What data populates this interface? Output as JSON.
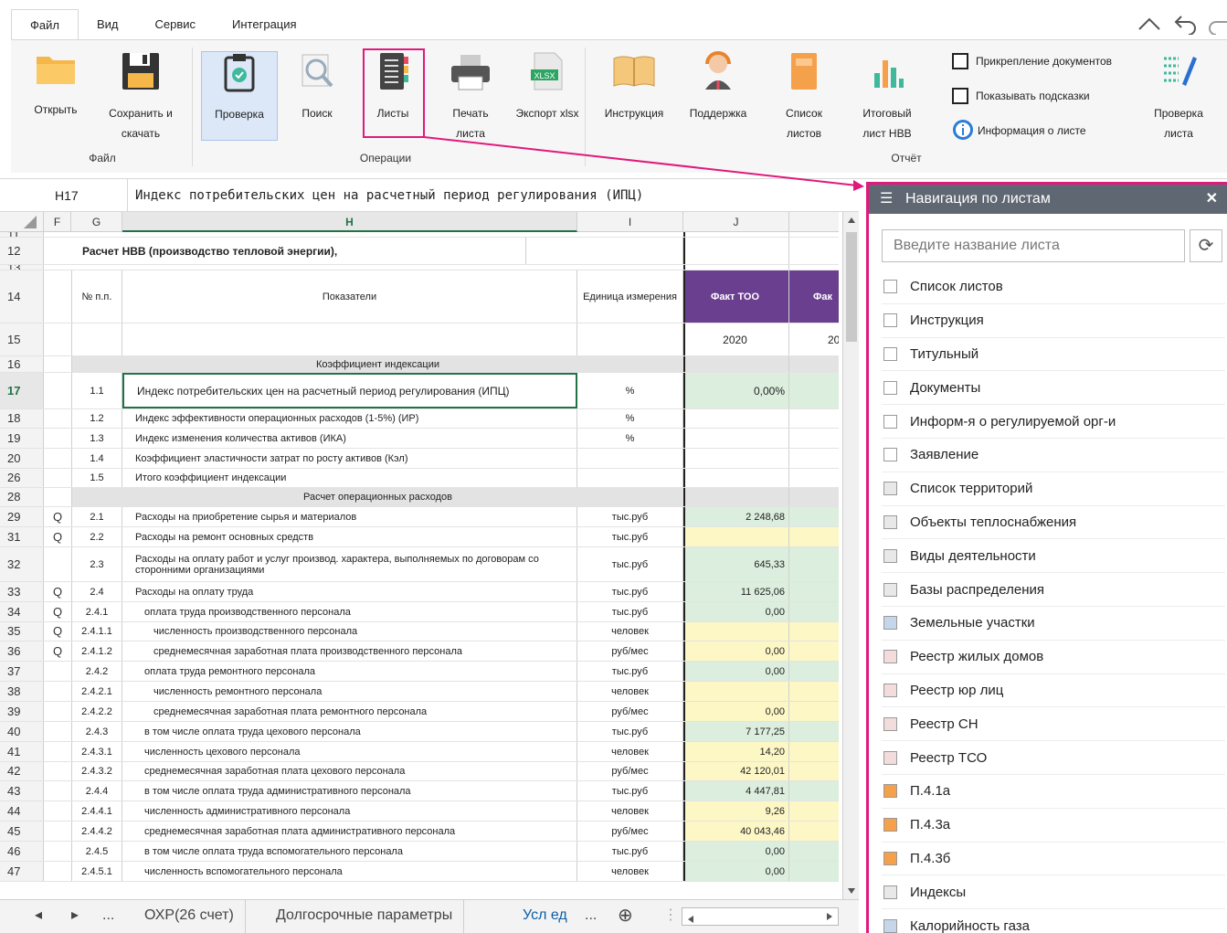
{
  "ribbon": {
    "tabs": [
      "Файл",
      "Вид",
      "Сервис",
      "Интеграция"
    ],
    "buttons": {
      "open": "Открыть",
      "save": "Сохранить и скачать",
      "check": "Проверка",
      "search": "Поиск",
      "sheets": "Листы",
      "print": "Печать листа",
      "export": "Экспорт xlsx",
      "export_badge": "XLSX",
      "instructions": "Инструкция",
      "support": "Поддержка",
      "sheet_list": "Список листов",
      "total_sheet": "Итоговый лист НВВ",
      "check_sheet": "Проверка листа"
    },
    "groups": {
      "file": "Файл",
      "operations": "Операции",
      "report": "Отчёт"
    },
    "checks": {
      "attach": "Прикрепление документов",
      "hints": "Показывать подсказки",
      "info": "Информация о листе"
    }
  },
  "formula_bar": {
    "cell_ref": "H17",
    "formula": "Индекс потребительских цен на расчетный период регулирования (ИПЦ)"
  },
  "grid": {
    "columns": [
      "F",
      "G",
      "H",
      "I",
      "J"
    ],
    "rows": [
      {
        "n": "11",
        "h": 6
      },
      {
        "n": "12",
        "h": 30,
        "h_text": "Расчет НВВ (производство тепловой энергии),",
        "bold": true
      },
      {
        "n": "13",
        "h": 6
      },
      {
        "n": "14",
        "h": 58,
        "g": "№ п.п.",
        "h_text": "Показатели",
        "i": "Единица измерения",
        "j": "Факт ТОО",
        "k": "Фак",
        "header": true
      },
      {
        "n": "15",
        "h": 36,
        "j": "2020",
        "k": "20",
        "j_center": true
      },
      {
        "n": "16",
        "h": 18,
        "section": "Коэффициент индексации"
      },
      {
        "n": "17",
        "h": 40,
        "g": "1.1",
        "h_text": "Индекс потребительских цен на расчетный период регулирования (ИПЦ)",
        "i": "%",
        "j": "0,00%",
        "fill": "green",
        "selected": true
      },
      {
        "n": "18",
        "h": 21,
        "g": "1.2",
        "h_text": "Индекс эффективности операционных расходов (1-5%) (ИР)",
        "i": "%"
      },
      {
        "n": "19",
        "h": 22,
        "g": "1.3",
        "h_text": "Индекс изменения количества активов (ИКА)",
        "i": "%"
      },
      {
        "n": "20",
        "h": 22,
        "g": "1.4",
        "h_text": "Коэффициент эластичности затрат по росту активов (Кэл)"
      },
      {
        "n": "26",
        "h": 21,
        "g": "1.5",
        "h_text": "Итого коэффициент индексации"
      },
      {
        "n": "28",
        "h": 21,
        "section": "Расчет операционных расходов"
      },
      {
        "n": "29",
        "h": 22,
        "f": "Q",
        "g": "2.1",
        "h_text": "Расходы на приобретение сырья и материалов",
        "i": "тыс.руб",
        "j": "2 248,68",
        "fill": "green"
      },
      {
        "n": "31",
        "h": 22,
        "f": "Q",
        "g": "2.2",
        "h_text": "Расходы на ремонт основных средств",
        "i": "тыс.руб",
        "j": "",
        "fill": "yellow"
      },
      {
        "n": "32",
        "h": 38,
        "g": "2.3",
        "h_text": "Расходы на оплату работ и услуг производ. характера, выполняемых по договорам со сторонними организациями",
        "i": "тыс.руб",
        "j": "645,33",
        "fill": "green",
        "wrap": true
      },
      {
        "n": "33",
        "h": 22,
        "f": "Q",
        "g": "2.4",
        "h_text": "Расходы на оплату труда",
        "i": "тыс.руб",
        "j": "11 625,06",
        "fill": "green"
      },
      {
        "n": "34",
        "h": 22,
        "f": "Q",
        "g": "2.4.1",
        "h_text": "оплата труда производственного персонала",
        "i": "тыс.руб",
        "j": "0,00",
        "fill": "green",
        "indent": 1
      },
      {
        "n": "35",
        "h": 21,
        "f": "Q",
        "g": "2.4.1.1",
        "h_text": "численность производственного персонала",
        "i": "человек",
        "j": "",
        "fill": "yellow",
        "indent": 2
      },
      {
        "n": "36",
        "h": 22,
        "f": "Q",
        "g": "2.4.1.2",
        "h_text": "среднемесячная заработная плата производственного персонала",
        "i": "руб/мес",
        "j": "0,00",
        "fill": "yellow",
        "indent": 2
      },
      {
        "n": "37",
        "h": 22,
        "g": "2.4.2",
        "h_text": "оплата труда ремонтного персонала",
        "i": "тыс.руб",
        "j": "0,00",
        "fill": "green",
        "indent": 1
      },
      {
        "n": "38",
        "h": 22,
        "g": "2.4.2.1",
        "h_text": "численность ремонтного персонала",
        "i": "человек",
        "j": "",
        "fill": "yellow",
        "indent": 2
      },
      {
        "n": "39",
        "h": 22,
        "g": "2.4.2.2",
        "h_text": "среднемесячная заработная плата ремонтного персонала",
        "i": "руб/мес",
        "j": "0,00",
        "fill": "yellow",
        "indent": 2
      },
      {
        "n": "40",
        "h": 22,
        "g": "2.4.3",
        "h_text": "в том числе оплата труда цехового персонала",
        "i": "тыс.руб",
        "j": "7 177,25",
        "fill": "green",
        "indent": 1
      },
      {
        "n": "41",
        "h": 22,
        "g": "2.4.3.1",
        "h_text": "численность цехового персонала",
        "i": "человек",
        "j": "14,20",
        "fill": "yellow",
        "indent": 1
      },
      {
        "n": "42",
        "h": 21,
        "g": "2.4.3.2",
        "h_text": "среднемесячная заработная плата цехового персонала",
        "i": "руб/мес",
        "j": "42 120,01",
        "fill": "yellow",
        "indent": 1
      },
      {
        "n": "43",
        "h": 22,
        "g": "2.4.4",
        "h_text": "в том числе оплата труда административного персонала",
        "i": "тыс.руб",
        "j": "4 447,81",
        "fill": "green",
        "indent": 1
      },
      {
        "n": "44",
        "h": 22,
        "g": "2.4.4.1",
        "h_text": "численность административного персонала",
        "i": "человек",
        "j": "9,26",
        "fill": "yellow",
        "indent": 1
      },
      {
        "n": "45",
        "h": 22,
        "g": "2.4.4.2",
        "h_text": "среднемесячная заработная плата административного персонала",
        "i": "руб/мес",
        "j": "40 043,46",
        "fill": "yellow",
        "indent": 1
      },
      {
        "n": "46",
        "h": 22,
        "g": "2.4.5",
        "h_text": "в том числе оплата труда вспомогательного персонала",
        "i": "тыс.руб",
        "j": "0,00",
        "fill": "green",
        "indent": 1
      },
      {
        "n": "47",
        "h": 22,
        "g": "2.4.5.1",
        "h_text": "численность вспомогательного персонала",
        "i": "человек",
        "j": "0,00",
        "fill": "green",
        "indent": 1
      }
    ]
  },
  "sheet_tabs": {
    "prev": "◂",
    "next": "▸",
    "more_left": "...",
    "tabs": [
      "ОХР(26 счет)",
      "Долгосрочные параметры",
      "Усл ед"
    ],
    "more_right": "...",
    "add": "⊕",
    "handle": "⋮"
  },
  "nav_panel": {
    "title": "Навигация по листам",
    "search_placeholder": "Введите название листа",
    "items": [
      {
        "label": "Список листов",
        "color": "#ffffff"
      },
      {
        "label": "Инструкция",
        "color": "#ffffff"
      },
      {
        "label": "Титульный",
        "color": "#ffffff"
      },
      {
        "label": "Документы",
        "color": "#ffffff"
      },
      {
        "label": "Информ-я о регулируемой орг-и",
        "color": "#ffffff"
      },
      {
        "label": "Заявление",
        "color": "#ffffff"
      },
      {
        "label": "Список территорий",
        "color": "#e8e8e8"
      },
      {
        "label": "Объекты теплоснабжения",
        "color": "#e8e8e8"
      },
      {
        "label": "Виды деятельности",
        "color": "#e8e8e8"
      },
      {
        "label": "Базы распределения",
        "color": "#e8e8e8"
      },
      {
        "label": "Земельные участки",
        "color": "#c5d6ea"
      },
      {
        "label": "Реестр жилых домов",
        "color": "#f3dcdc"
      },
      {
        "label": "Реестр юр лиц",
        "color": "#f3dcdc"
      },
      {
        "label": "Реестр СН",
        "color": "#f3dcdc"
      },
      {
        "label": "Реестр ТСО",
        "color": "#f3dcdc"
      },
      {
        "label": "П.4.1а",
        "color": "#f5a04a"
      },
      {
        "label": "П.4.3а",
        "color": "#f5a04a"
      },
      {
        "label": "П.4.3б",
        "color": "#f5a04a"
      },
      {
        "label": "Индексы",
        "color": "#e8e8e8"
      },
      {
        "label": "Калорийность газа",
        "color": "#c5d6ea"
      }
    ]
  },
  "colors": {
    "accent": "#e0197d",
    "header_purple": "#6b3f8f",
    "fill_green": "#dceedd",
    "fill_yellow": "#fdf7c6",
    "section_grey": "#e3e3e3"
  }
}
